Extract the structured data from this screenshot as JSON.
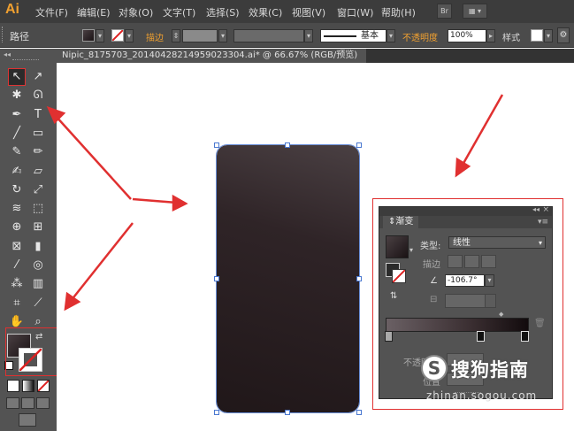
{
  "app": {
    "logo": "Ai"
  },
  "menu": [
    "文件(F)",
    "编辑(E)",
    "对象(O)",
    "文字(T)",
    "选择(S)",
    "效果(C)",
    "视图(V)",
    "窗口(W)",
    "帮助(H)"
  ],
  "menu_buttons": {
    "bridge": "Br"
  },
  "control_bar": {
    "selection_label": "路径",
    "stroke_label": "描边",
    "stroke_style": "基本",
    "opacity_label": "不透明度",
    "opacity_value": "100%",
    "style_label": "样式"
  },
  "document_tab": {
    "title": "Nipic_8175703_20140428214959023304.ai* @ 66.67% (RGB/预览)",
    "close": "×"
  },
  "toolbar": {
    "tools": [
      {
        "name": "selection-tool",
        "glyph": "↖"
      },
      {
        "name": "direct-selection-tool",
        "glyph": "↗"
      },
      {
        "name": "magic-wand-tool",
        "glyph": "✱"
      },
      {
        "name": "lasso-tool",
        "glyph": "ᘏ"
      },
      {
        "name": "pen-tool",
        "glyph": "✒"
      },
      {
        "name": "type-tool",
        "glyph": "T"
      },
      {
        "name": "line-tool",
        "glyph": "╱"
      },
      {
        "name": "rectangle-tool",
        "glyph": "▭"
      },
      {
        "name": "paintbrush-tool",
        "glyph": "✎"
      },
      {
        "name": "pencil-tool",
        "glyph": "✏"
      },
      {
        "name": "blob-brush-tool",
        "glyph": "✍"
      },
      {
        "name": "eraser-tool",
        "glyph": "▱"
      },
      {
        "name": "rotate-tool",
        "glyph": "↻"
      },
      {
        "name": "scale-tool",
        "glyph": "⤢"
      },
      {
        "name": "warp-tool",
        "glyph": "≋"
      },
      {
        "name": "free-transform-tool",
        "glyph": "⬚"
      },
      {
        "name": "shape-builder-tool",
        "glyph": "⊕"
      },
      {
        "name": "perspective-grid-tool",
        "glyph": "⊞"
      },
      {
        "name": "mesh-tool",
        "glyph": "⊠"
      },
      {
        "name": "gradient-tool",
        "glyph": "▮"
      },
      {
        "name": "eyedropper-tool",
        "glyph": "⁄"
      },
      {
        "name": "blend-tool",
        "glyph": "◎"
      },
      {
        "name": "symbol-sprayer-tool",
        "glyph": "⁂"
      },
      {
        "name": "column-graph-tool",
        "glyph": "▥"
      },
      {
        "name": "artboard-tool",
        "glyph": "⌗"
      },
      {
        "name": "slice-tool",
        "glyph": "⟋"
      },
      {
        "name": "hand-tool",
        "glyph": "✋"
      },
      {
        "name": "zoom-tool",
        "glyph": "⌕"
      }
    ]
  },
  "gradient_panel": {
    "title": "渐变",
    "type_label": "类型:",
    "type_value": "线性",
    "stroke_label": "描边",
    "angle_value": "-106.7°",
    "opacity_label": "不透明度",
    "position_label": "位置"
  },
  "watermark": {
    "logo": "S",
    "text": "搜狗指南",
    "url": "zhinan.sogou.com"
  },
  "colors": {
    "ui_dark": "#535353",
    "menubar": "#3c3c3c",
    "accent_orange": "#f0a030",
    "annotation_red": "#e03030",
    "selection_blue": "#4a78d0",
    "gradient_start": "#4a4043",
    "gradient_end": "#201719"
  }
}
